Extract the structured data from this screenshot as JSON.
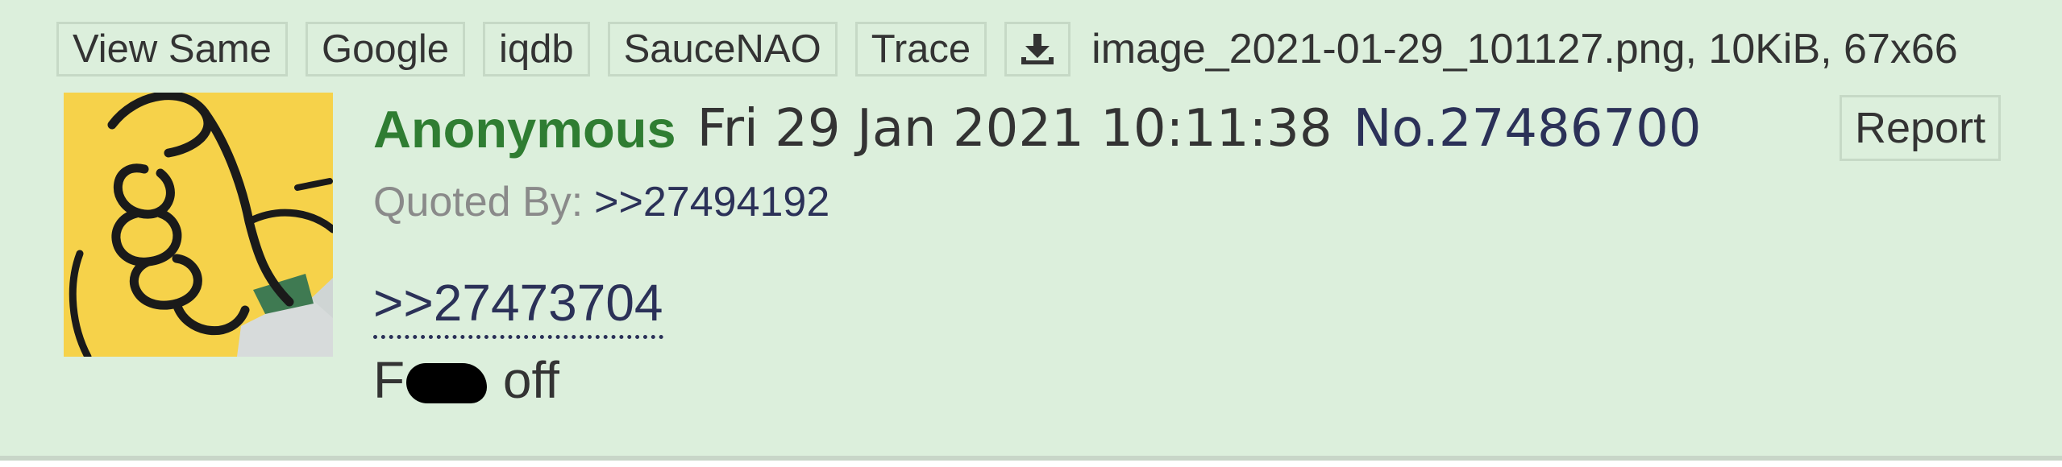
{
  "toolbar": {
    "buttons": [
      {
        "label": "View Same"
      },
      {
        "label": "Google"
      },
      {
        "label": "iqdb"
      },
      {
        "label": "SauceNAO"
      },
      {
        "label": "Trace"
      }
    ],
    "download_icon": "download-icon"
  },
  "file_info": "image_2021-01-29_101127.png, 10KiB, 67x66",
  "post": {
    "name": "Anonymous",
    "date": "Fri 29 Jan 2021 10:11:38",
    "number": "No.27486700",
    "report_label": "Report",
    "quoted_by_label": "Quoted By:",
    "quoted_by_link": ">>27494192",
    "quote_link": ">>27473704",
    "message_start": "F",
    "message_end": " off"
  },
  "colors": {
    "background": "#dcefdc",
    "name": "#2f7d32",
    "link": "#2b3158",
    "text": "#333333"
  }
}
